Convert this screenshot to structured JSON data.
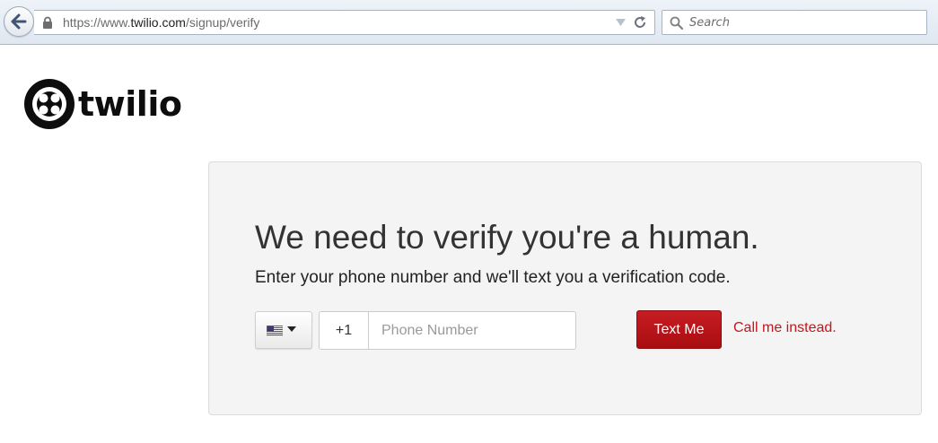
{
  "browser": {
    "url_scheme_path_prefix": "https://www.",
    "url_host": "twilio.com",
    "url_path": "/signup/verify",
    "search_placeholder": "Search"
  },
  "logo": {
    "text": "twilio"
  },
  "verify": {
    "headline": "We need to verify you're a human.",
    "subheadline": "Enter your phone number and we'll text you a verification code.",
    "country_flag": "us-flag-icon",
    "dial_code": "+1",
    "phone_placeholder": "Phone Number",
    "phone_value": "",
    "text_me_label": "Text Me",
    "call_link_label": "Call me instead."
  },
  "colors": {
    "brand_red": "#c4161c",
    "card_background": "#f4f4f4",
    "logo_black": "#0d0d0d"
  }
}
